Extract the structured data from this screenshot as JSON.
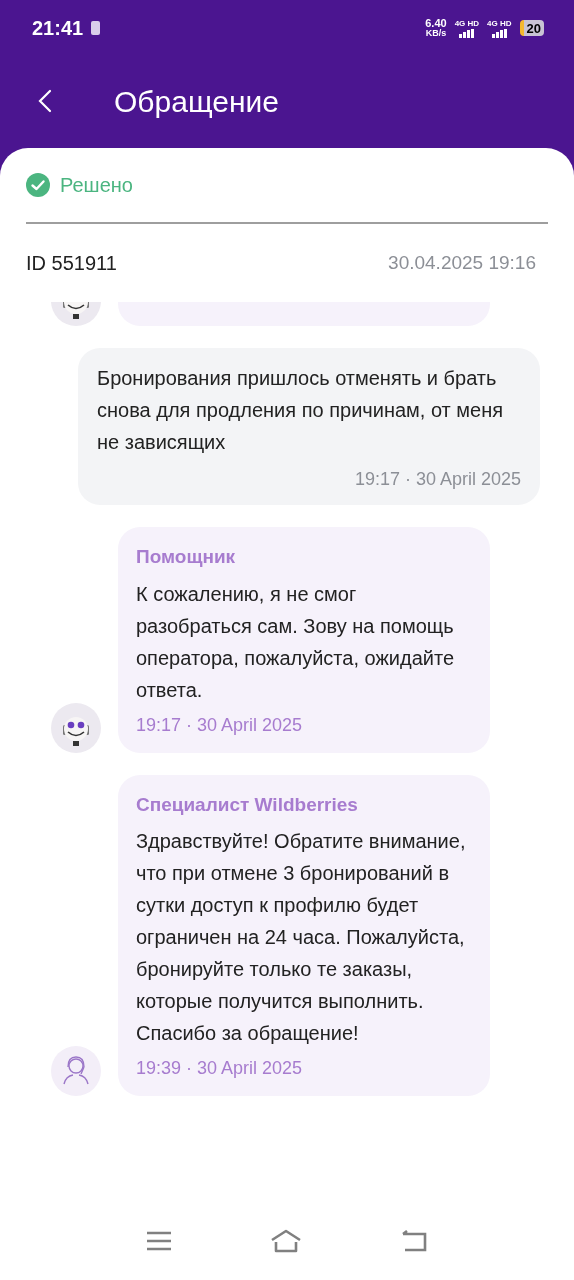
{
  "status_bar": {
    "time": "21:41",
    "speed": "6.40",
    "speed_unit": "KB/s",
    "sims": [
      "4G HD",
      "4G HD"
    ],
    "battery": "20"
  },
  "header": {
    "title": "Обращение"
  },
  "ticket": {
    "status": {
      "kind": "resolved",
      "label": "Решено"
    },
    "id": "ID 551911",
    "date": "30.04.2025 19:16"
  },
  "messages": [
    {
      "kind": "partial"
    },
    {
      "kind": "user",
      "text": "Бронирования пришлось отменять и брать снова для продления по причинам, от меня не зависящих",
      "time": "19:17 · 30 April 2025"
    },
    {
      "kind": "bot",
      "sender": "Помощник",
      "text": "К сожалению, я не смог разобраться сам. Зову на помощь оператора, пожалуйста, ожидайте ответа.",
      "time": "19:17 · 30 April 2025"
    },
    {
      "kind": "operator",
      "sender": "Специалист Wildberries",
      "text": "Здравствуйте! Обратите внимание, что при отмене 3 бронирований в сутки доступ к профилю будет ограничен на 24 часа. Пожалуйста, бронируйте только те заказы, которые получится выполнить. Спасибо за обращение!",
      "time": "19:39 · 30 April 2025"
    }
  ]
}
